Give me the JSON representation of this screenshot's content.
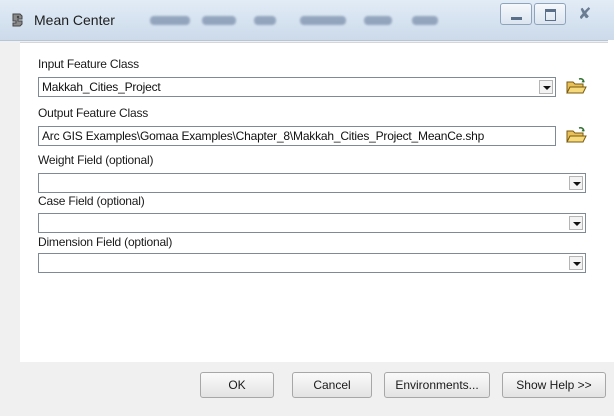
{
  "window": {
    "title": "Mean Center",
    "app_icon": "toolbox-icon",
    "controls": {
      "minimize": "minimize-icon",
      "maximize": "maximize-icon",
      "close_glyph": "✘"
    }
  },
  "form": {
    "input_feature_class": {
      "label": "Input Feature Class",
      "value": "Makkah_Cities_Project",
      "browse_icon": "open-folder-icon"
    },
    "output_feature_class": {
      "label": "Output Feature Class",
      "value": "Arc GIS Examples\\Gomaa Examples\\Chapter_8\\Makkah_Cities_Project_MeanCe.shp",
      "browse_icon": "open-folder-icon"
    },
    "weight_field": {
      "label": "Weight Field (optional)",
      "value": ""
    },
    "case_field": {
      "label": "Case Field (optional)",
      "value": ""
    },
    "dimension_field": {
      "label": "Dimension Field (optional)",
      "value": ""
    }
  },
  "buttons": {
    "ok": "OK",
    "cancel": "Cancel",
    "environments": "Environments...",
    "show_help": "Show Help >>"
  }
}
